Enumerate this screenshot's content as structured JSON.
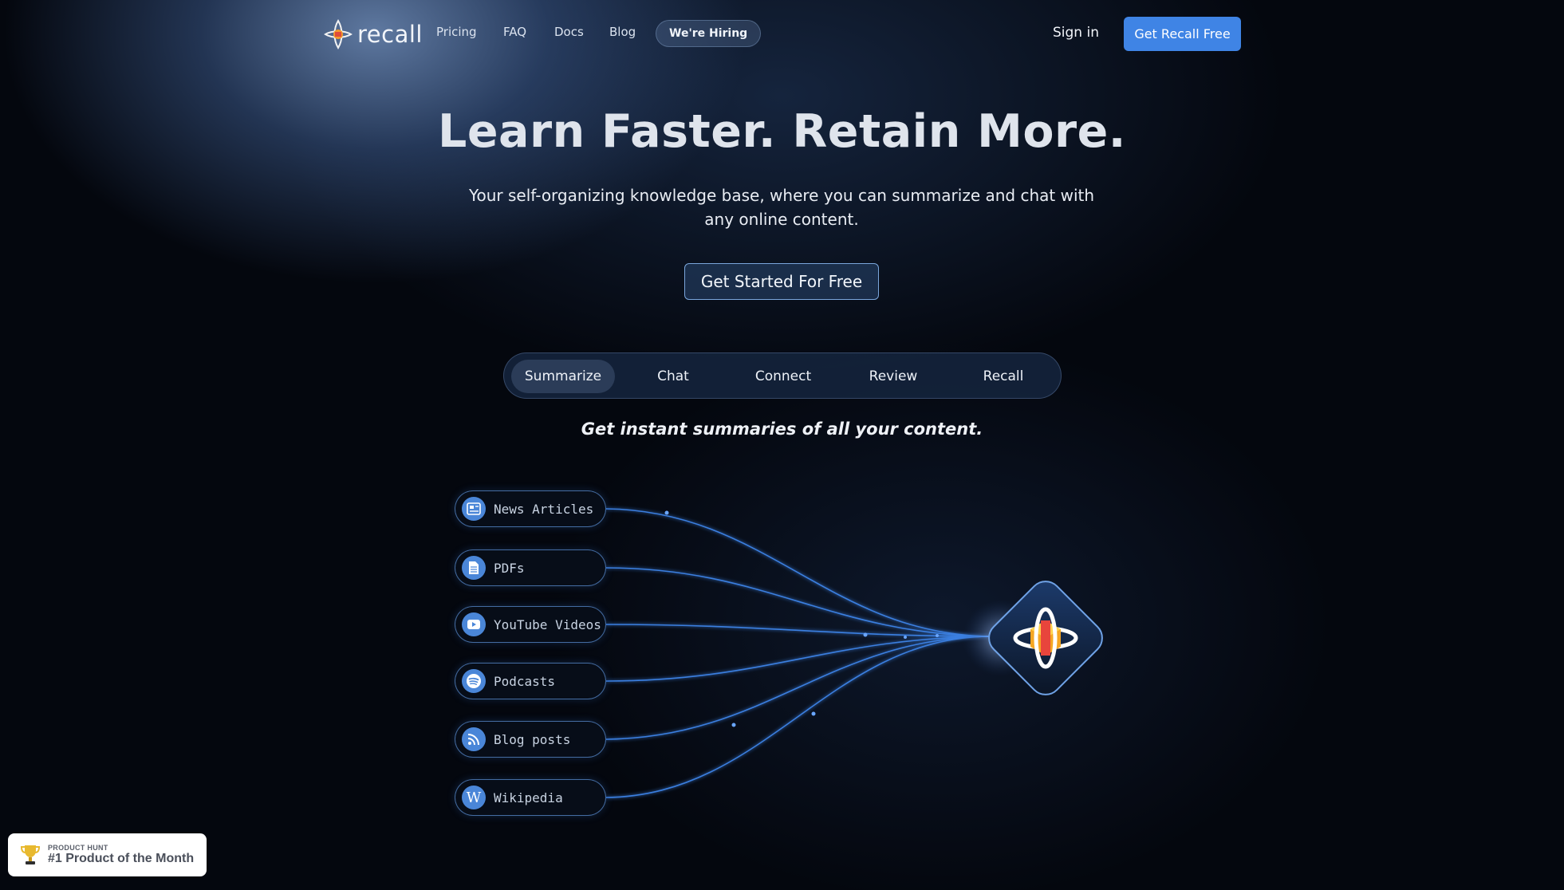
{
  "nav": {
    "logo_text": "recall",
    "links": [
      "Pricing",
      "FAQ",
      "Docs",
      "Blog"
    ],
    "hiring_label": "We're Hiring",
    "signin_label": "Sign in",
    "cta_label": "Get Recall Free"
  },
  "hero": {
    "title": "Learn Faster. Retain More.",
    "subtitle": "Your self-organizing knowledge base, where you can summarize and chat with any online content.",
    "cta_label": "Get Started For Free"
  },
  "tabs": {
    "items": [
      "Summarize",
      "Chat",
      "Connect",
      "Review",
      "Recall"
    ],
    "active": "Summarize"
  },
  "tagline": "Get instant summaries of all your content.",
  "sources": [
    {
      "label": "News Articles",
      "icon": "newspaper-icon"
    },
    {
      "label": "PDFs",
      "icon": "document-icon"
    },
    {
      "label": "YouTube Videos",
      "icon": "youtube-icon"
    },
    {
      "label": "Podcasts",
      "icon": "spotify-icon"
    },
    {
      "label": "Blog posts",
      "icon": "rss-icon"
    },
    {
      "label": "Wikipedia",
      "icon": "wikipedia-icon"
    }
  ],
  "badge": {
    "small": "PRODUCT HUNT",
    "big": "#1 Product of the Month"
  },
  "colors": {
    "accent": "#3f84e5",
    "background": "#04070e",
    "line": "#3a7fe0"
  }
}
